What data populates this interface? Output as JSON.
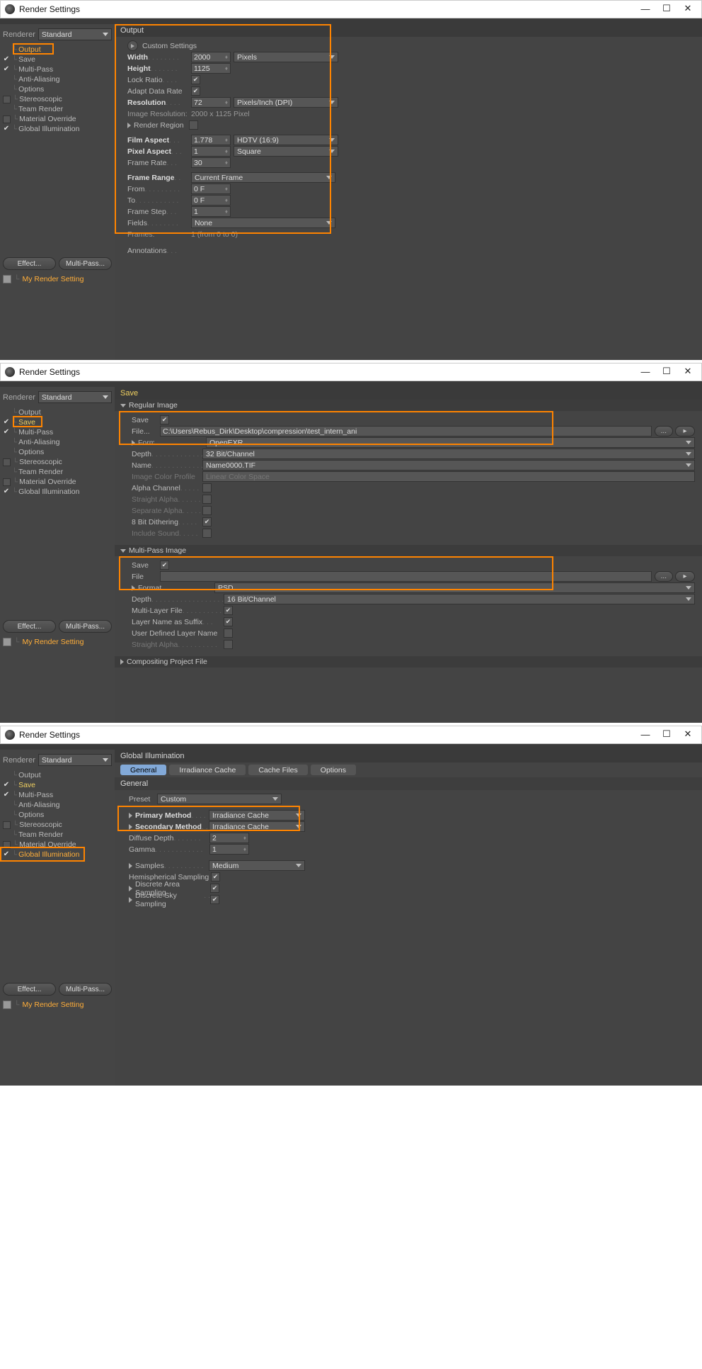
{
  "title": "Render Settings",
  "rendererLabel": "Renderer",
  "rendererValue": "Standard",
  "sideItems": [
    "Output",
    "Save",
    "Multi-Pass",
    "Anti-Aliasing",
    "Options",
    "Stereoscopic",
    "Team Render",
    "Material Override",
    "Global Illumination"
  ],
  "effectBtn": "Effect...",
  "multiPassBtn": "Multi-Pass...",
  "presetName": "My Render Setting",
  "p1": {
    "header": "Output",
    "custom": "Custom Settings",
    "width": "Width",
    "widthV": "2000",
    "widthUnit": "Pixels",
    "height": "Height",
    "heightV": "1125",
    "lock": "Lock Ratio",
    "adapt": "Adapt Data Rate",
    "res": "Resolution",
    "resV": "72",
    "resUnit": "Pixels/Inch (DPI)",
    "imgRes": "Image Resolution:",
    "imgResV": "2000 x 1125 Pixel",
    "region": "Render Region",
    "film": "Film Aspect",
    "filmV": "1.778",
    "filmPreset": "HDTV (16:9)",
    "pixel": "Pixel Aspect",
    "pixelV": "1",
    "pixelPreset": "Square",
    "frate": "Frame Rate",
    "frateV": "30",
    "range": "Frame Range",
    "rangeV": "Current Frame",
    "from": "From",
    "fromV": "0 F",
    "to": "To",
    "toV": "0 F",
    "step": "Frame Step",
    "stepV": "1",
    "fields": "Fields",
    "fieldsV": "None",
    "frames": "Frames:",
    "framesV": "1 (from 0 to 0)",
    "ann": "Annotations"
  },
  "p2": {
    "header": "Save",
    "reg": "Regular Image",
    "save": "Save",
    "file": "File...",
    "fileV": "C:\\Users\\Rebus_Dirk\\Desktop\\compression\\test_intern_ani",
    "format": "Format",
    "formatV": "OpenEXR",
    "depth": "Depth",
    "depthV": "32 Bit/Channel",
    "name": "Name",
    "nameV": "Name0000.TIF",
    "icp": "Image Color Profile",
    "icpV": "Linear Color Space",
    "alpha": "Alpha Channel",
    "straight": "Straight Alpha",
    "sep": "Separate Alpha",
    "dither": "8 Bit Dithering",
    "sound": "Include Sound",
    "mp": "Multi-Pass Image",
    "mpSave": "Save",
    "mpFile": "File",
    "mpFormat": "Format",
    "mpFormatV": "PSD",
    "mpDepth": "Depth",
    "mpDepthV": "16 Bit/Channel",
    "mlf": "Multi-Layer File",
    "lns": "Layer Name as Suffix",
    "udln": "User Defined Layer Name",
    "mpStraight": "Straight Alpha",
    "cpf": "Compositing Project File"
  },
  "p3": {
    "header": "Global Illumination",
    "tabs": [
      "General",
      "Irradiance Cache",
      "Cache Files",
      "Options"
    ],
    "sub": "General",
    "preset": "Preset",
    "presetV": "Custom",
    "pm": "Primary Method",
    "pmV": "Irradiance Cache",
    "sm": "Secondary Method",
    "smV": "Irradiance Cache",
    "dd": "Diffuse Depth",
    "ddV": "2",
    "gamma": "Gamma",
    "gammaV": "1",
    "samples": "Samples",
    "samplesV": "Medium",
    "hemi": "Hemispherical Sampling",
    "area": "Discrete Area Sampling",
    "sky": "Discrete Sky Sampling"
  }
}
